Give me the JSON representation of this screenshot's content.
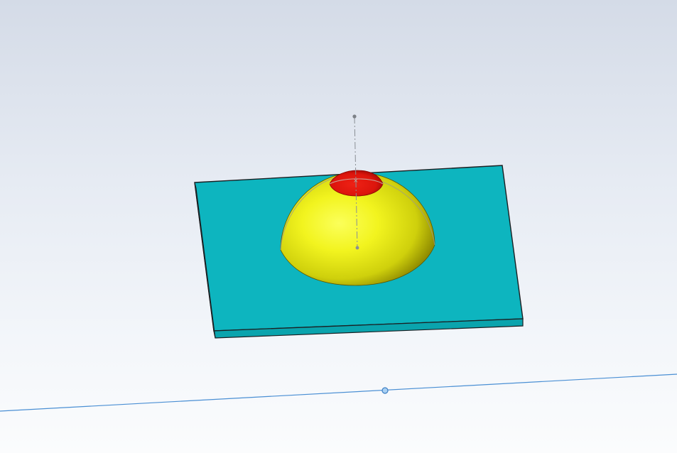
{
  "viewport": {
    "background_top": "#d4dbe7",
    "background_bottom": "#fbfcfd"
  },
  "model": {
    "plate_top_color": "#0db5bf",
    "plate_side_color": "#0aa4ad",
    "plate_edge_color": "#1a1f22",
    "dome_highlight_color": "#f8ff3a",
    "dome_base_color": "#d8dc10",
    "dome_shadow_color": "#6b6400",
    "cap_color": "#e3170f",
    "cap_shadow_color": "#a10805"
  },
  "reference": {
    "axis_color": "#8a8f95",
    "ground_line_color": "#4a8fd4",
    "handle_color": "#6fa8e3"
  }
}
